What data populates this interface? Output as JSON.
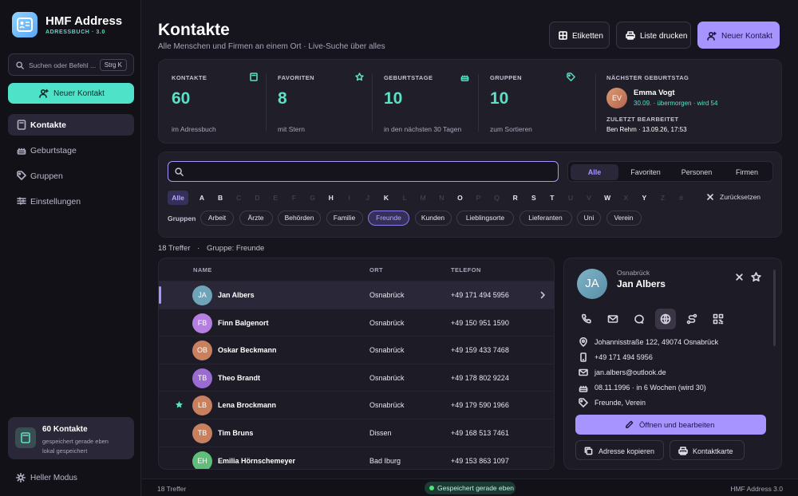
{
  "app": {
    "name": "HMF Address",
    "subtitle": "ADRESSBUCH · 3.0"
  },
  "sidebar": {
    "search_placeholder": "Suchen oder Befehl ...",
    "search_shortcut": "Strg K",
    "new_contact": "Neuer Kontakt",
    "nav": [
      {
        "label": "Kontakte",
        "icon": "contacts-book-icon",
        "active": true
      },
      {
        "label": "Geburtstage",
        "icon": "cake-icon",
        "active": false
      },
      {
        "label": "Gruppen",
        "icon": "tag-icon",
        "active": false
      },
      {
        "label": "Einstellungen",
        "icon": "sliders-icon",
        "active": false
      }
    ],
    "card": {
      "title": "60 Kontakte",
      "line1": "gespeichert gerade eben",
      "line2": "lokal gespeichert"
    },
    "mode": "Heller Modus"
  },
  "header": {
    "title": "Kontakte",
    "subtitle": "Alle Menschen und Firmen an einem Ort · Live-Suche über alles",
    "btn_labels": "Etiketten",
    "btn_print": "Liste drucken",
    "btn_new": "Neuer Kontakt"
  },
  "stats": [
    {
      "label": "KONTAKTE",
      "value": "60",
      "sub": "im Adressbuch",
      "icon": "book-icon"
    },
    {
      "label": "FAVORITEN",
      "value": "8",
      "sub": "mit Stern",
      "icon": "star-icon"
    },
    {
      "label": "GEBURTSTAGE",
      "value": "10",
      "sub": "in den nächsten 30 Tagen",
      "icon": "cake-icon"
    },
    {
      "label": "GRUPPEN",
      "value": "10",
      "sub": "zum Sortieren",
      "icon": "tag-icon"
    }
  ],
  "next_birthday": {
    "label": "NÄCHSTER GEBURTSTAG",
    "initials": "EV",
    "name": "Emma Vogt",
    "info": "30.09. · übermorgen · wird 54",
    "last_edited_label": "ZULETZT BEARBEITET",
    "last_edited_value": "Ben Rehm · 13.09.26, 17:53"
  },
  "filter": {
    "search_value": "",
    "segments": [
      {
        "label": "Alle",
        "active": true
      },
      {
        "label": "Favoriten",
        "active": false
      },
      {
        "label": "Personen",
        "active": false
      },
      {
        "label": "Firmen",
        "active": false
      }
    ],
    "letters": [
      {
        "l": "Alle",
        "state": "active"
      },
      {
        "l": "A",
        "state": "on"
      },
      {
        "l": "B",
        "state": "on"
      },
      {
        "l": "C",
        "state": "dim"
      },
      {
        "l": "D",
        "state": "dim"
      },
      {
        "l": "E",
        "state": "dim"
      },
      {
        "l": "F",
        "state": "dim"
      },
      {
        "l": "G",
        "state": "dim"
      },
      {
        "l": "H",
        "state": "on"
      },
      {
        "l": "I",
        "state": "dim"
      },
      {
        "l": "J",
        "state": "dim"
      },
      {
        "l": "K",
        "state": "on"
      },
      {
        "l": "L",
        "state": "dim"
      },
      {
        "l": "M",
        "state": "dim"
      },
      {
        "l": "N",
        "state": "dim"
      },
      {
        "l": "O",
        "state": "on"
      },
      {
        "l": "P",
        "state": "dim"
      },
      {
        "l": "Q",
        "state": "dim"
      },
      {
        "l": "R",
        "state": "on"
      },
      {
        "l": "S",
        "state": "on"
      },
      {
        "l": "T",
        "state": "on"
      },
      {
        "l": "U",
        "state": "dim"
      },
      {
        "l": "V",
        "state": "dim"
      },
      {
        "l": "W",
        "state": "on"
      },
      {
        "l": "X",
        "state": "dim"
      },
      {
        "l": "Y",
        "state": "on"
      },
      {
        "l": "Z",
        "state": "dim"
      },
      {
        "l": "#",
        "state": "dim"
      }
    ],
    "reset": "Zurücksetzen",
    "groups_label": "Gruppen",
    "groups": [
      {
        "label": "Arbeit",
        "active": false
      },
      {
        "label": "Ärzte",
        "active": false
      },
      {
        "label": "Behörden",
        "active": false
      },
      {
        "label": "Familie",
        "active": false
      },
      {
        "label": "Freunde",
        "active": true
      },
      {
        "label": "Kunden",
        "active": false
      },
      {
        "label": "Lieblingsorte",
        "active": false
      },
      {
        "label": "Lieferanten",
        "active": false
      },
      {
        "label": "Uni",
        "active": false
      },
      {
        "label": "Verein",
        "active": false
      }
    ]
  },
  "results": {
    "hits": "18 Treffer",
    "sep": "·",
    "group": "Gruppe: Freunde"
  },
  "table": {
    "headers": {
      "name": "NAME",
      "ort": "ORT",
      "telefon": "TELEFON"
    },
    "rows": [
      {
        "initials": "JA",
        "name": "Jan Albers",
        "ort": "Osnabrück",
        "tel": "+49 171 494 5956",
        "fav": false,
        "selected": true,
        "color": "#6fa3b8"
      },
      {
        "initials": "FB",
        "name": "Finn Balgenort",
        "ort": "Osnabrück",
        "tel": "+49 150 951 1590",
        "fav": false,
        "selected": false,
        "color": "#b47fe0"
      },
      {
        "initials": "OB",
        "name": "Oskar Beckmann",
        "ort": "Osnabrück",
        "tel": "+49 159 433 7468",
        "fav": false,
        "selected": false,
        "color": "#c9805f"
      },
      {
        "initials": "TB",
        "name": "Theo Brandt",
        "ort": "Osnabrück",
        "tel": "+49 178 802 9224",
        "fav": false,
        "selected": false,
        "color": "#9b6bd1"
      },
      {
        "initials": "LB",
        "name": "Lena Brockmann",
        "ort": "Osnabrück",
        "tel": "+49 179 590 1966",
        "fav": true,
        "selected": false,
        "color": "#c9805f"
      },
      {
        "initials": "TB",
        "name": "Tim Bruns",
        "ort": "Dissen",
        "tel": "+49 168 513 7461",
        "fav": false,
        "selected": false,
        "color": "#c9805f"
      },
      {
        "initials": "EH",
        "name": "Emilia Hörnschemeyer",
        "ort": "Bad Iburg",
        "tel": "+49 153 863 1097",
        "fav": false,
        "selected": false,
        "color": "#5fbf7a"
      }
    ]
  },
  "detail": {
    "initials": "JA",
    "city": "Osnabrück",
    "name": "Jan Albers",
    "address": "Johannisstraße 122, 49074 Osnabrück",
    "phone": "+49 171 494 5956",
    "email": "jan.albers@outlook.de",
    "birthday": "08.11.1996 · in 6 Wochen (wird 30)",
    "groups": "Freunde, Verein",
    "open_btn": "Öffnen und bearbeiten",
    "copy_btn": "Adresse kopieren",
    "card_btn": "Kontaktkarte"
  },
  "footer": {
    "left": "18 Treffer",
    "status": "Gespeichert gerade eben",
    "right": "HMF Address 3.0"
  },
  "colors": {
    "accent": "#a894ff",
    "teal": "#5ce0c6",
    "mint_button": "#4ee3c9",
    "background": "#16141d"
  }
}
